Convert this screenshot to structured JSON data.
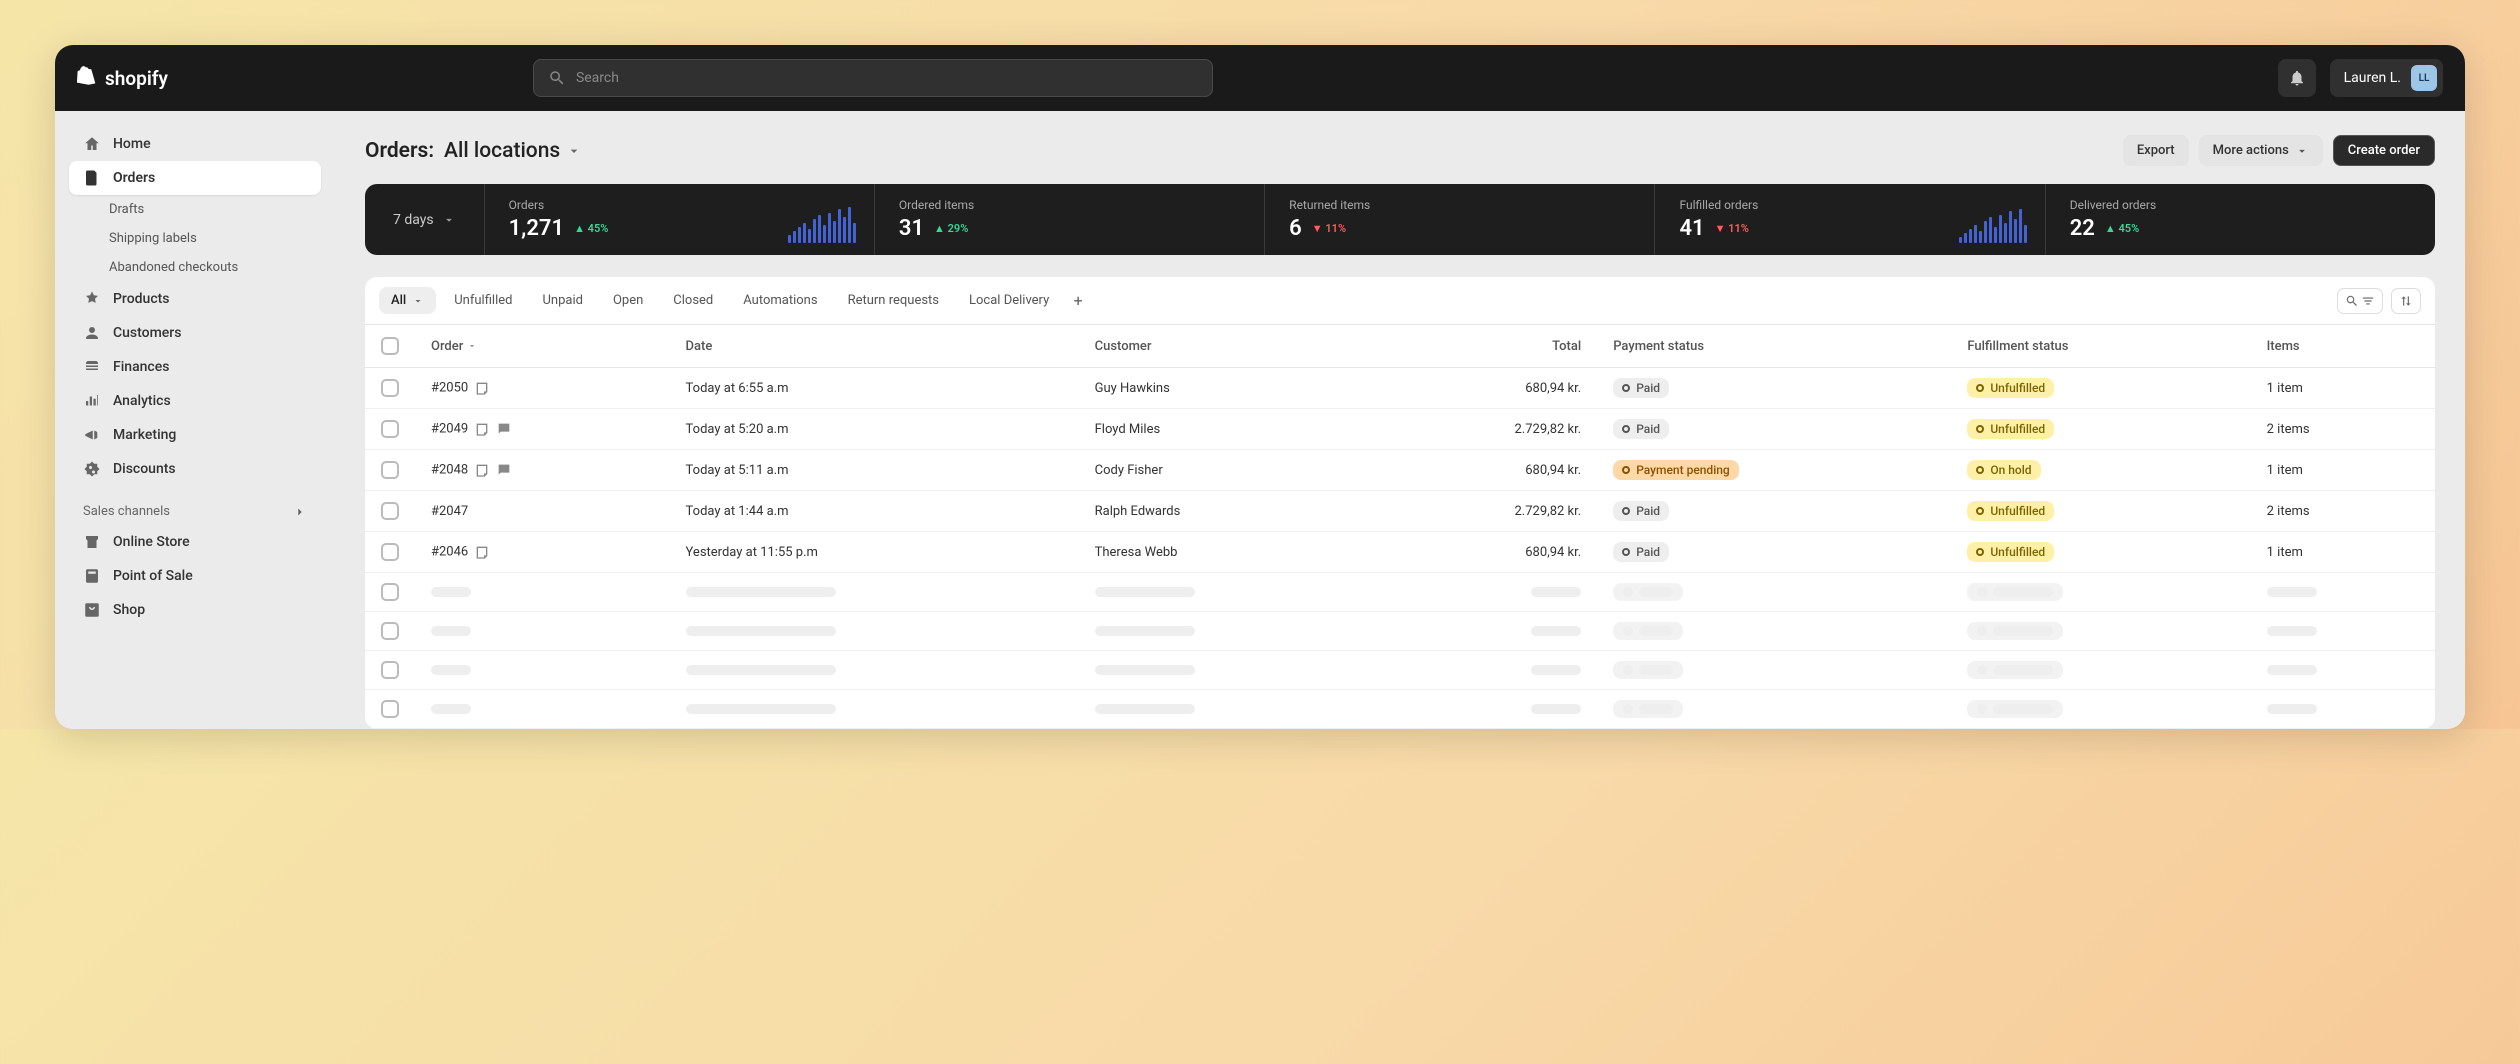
{
  "brand": "shopify",
  "search": {
    "placeholder": "Search"
  },
  "user": {
    "name": "Lauren L.",
    "initials": "LL"
  },
  "sidebar": {
    "items": [
      {
        "label": "Home",
        "icon": "home"
      },
      {
        "label": "Orders",
        "icon": "orders",
        "active": true
      },
      {
        "label": "Products",
        "icon": "products"
      },
      {
        "label": "Customers",
        "icon": "customers"
      },
      {
        "label": "Finances",
        "icon": "finances"
      },
      {
        "label": "Analytics",
        "icon": "analytics"
      },
      {
        "label": "Marketing",
        "icon": "marketing"
      },
      {
        "label": "Discounts",
        "icon": "discounts"
      }
    ],
    "orders_sub": [
      {
        "label": "Drafts"
      },
      {
        "label": "Shipping labels"
      },
      {
        "label": "Abandoned checkouts"
      }
    ],
    "channels_header": "Sales channels",
    "channels": [
      {
        "label": "Online Store",
        "icon": "store"
      },
      {
        "label": "Point of Sale",
        "icon": "pos"
      },
      {
        "label": "Shop",
        "icon": "shop"
      }
    ]
  },
  "page": {
    "title_prefix": "Orders:",
    "location": "All locations",
    "actions": {
      "export": "Export",
      "more": "More actions",
      "create": "Create order"
    }
  },
  "stats": {
    "range": "7 days",
    "items": [
      {
        "label": "Orders",
        "value": "1,271",
        "delta": "45%",
        "dir": "up",
        "bars": [
          8,
          12,
          16,
          20,
          14,
          24,
          28,
          18,
          30,
          22,
          34,
          26,
          36,
          20
        ]
      },
      {
        "label": "Ordered items",
        "value": "31",
        "delta": "29%",
        "dir": "up"
      },
      {
        "label": "Returned items",
        "value": "6",
        "delta": "11%",
        "dir": "down"
      },
      {
        "label": "Fulfilled orders",
        "value": "41",
        "delta": "11%",
        "dir": "down",
        "bars": [
          6,
          10,
          14,
          18,
          12,
          22,
          26,
          16,
          28,
          20,
          32,
          24,
          34,
          18
        ]
      },
      {
        "label": "Delivered orders",
        "value": "22",
        "delta": "45%",
        "dir": "up"
      }
    ]
  },
  "tabs": [
    {
      "label": "All",
      "active": true,
      "dropdown": true
    },
    {
      "label": "Unfulfilled"
    },
    {
      "label": "Unpaid"
    },
    {
      "label": "Open"
    },
    {
      "label": "Closed"
    },
    {
      "label": "Automations"
    },
    {
      "label": "Return requests"
    },
    {
      "label": "Local Delivery"
    }
  ],
  "columns": [
    "Order",
    "Date",
    "Customer",
    "Total",
    "Payment status",
    "Fulfillment status",
    "Items"
  ],
  "rows": [
    {
      "order": "#2050",
      "notes": 1,
      "date": "Today at 6:55 a.m",
      "customer": "Guy Hawkins",
      "total": "680,94 kr.",
      "payment": {
        "label": "Paid",
        "kind": "paid"
      },
      "fulfillment": {
        "label": "Unfulfilled",
        "kind": "unfulfilled"
      },
      "items": "1 item"
    },
    {
      "order": "#2049",
      "notes": 2,
      "date": "Today at 5:20 a.m",
      "customer": "Floyd Miles",
      "total": "2.729,82 kr.",
      "payment": {
        "label": "Paid",
        "kind": "paid"
      },
      "fulfillment": {
        "label": "Unfulfilled",
        "kind": "unfulfilled"
      },
      "items": "2 items"
    },
    {
      "order": "#2048",
      "notes": 2,
      "date": "Today at 5:11 a.m",
      "customer": "Cody Fisher",
      "total": "680,94 kr.",
      "payment": {
        "label": "Payment pending",
        "kind": "pending"
      },
      "fulfillment": {
        "label": "On hold",
        "kind": "hold"
      },
      "items": "1 item"
    },
    {
      "order": "#2047",
      "notes": 0,
      "date": "Today at 1:44 a.m",
      "customer": "Ralph Edwards",
      "total": "2.729,82 kr.",
      "payment": {
        "label": "Paid",
        "kind": "paid"
      },
      "fulfillment": {
        "label": "Unfulfilled",
        "kind": "unfulfilled"
      },
      "items": "2 items"
    },
    {
      "order": "#2046",
      "notes": 1,
      "date": "Yesterday at 11:55 p.m",
      "customer": "Theresa Webb",
      "total": "680,94 kr.",
      "payment": {
        "label": "Paid",
        "kind": "paid"
      },
      "fulfillment": {
        "label": "Unfulfilled",
        "kind": "unfulfilled"
      },
      "items": "1 item"
    }
  ],
  "skeleton_rows": 4
}
